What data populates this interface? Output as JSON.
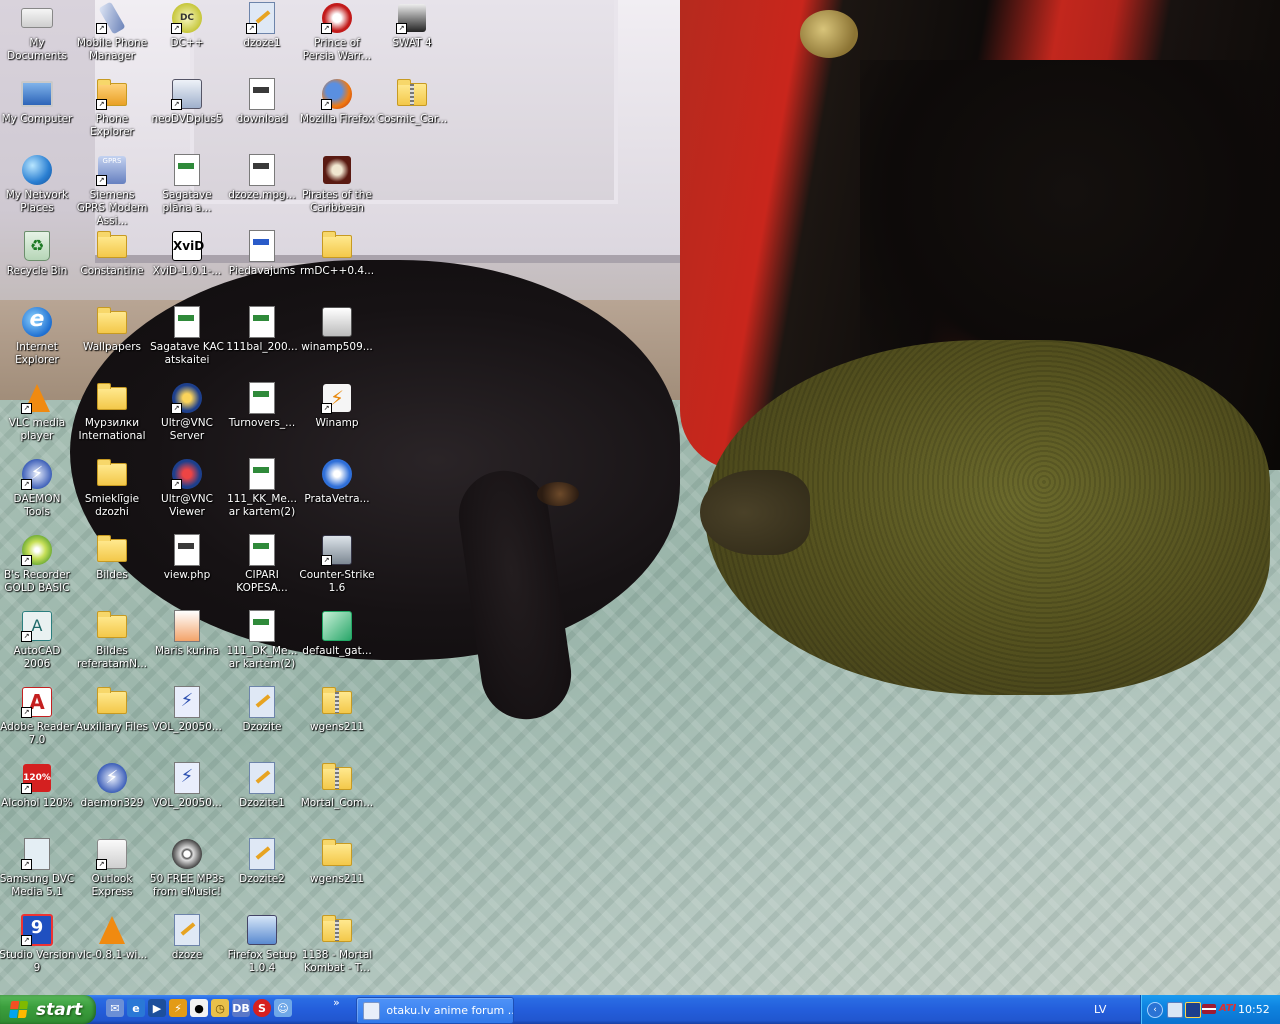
{
  "desktop": {
    "columns": [
      [
        {
          "label": "My Documents",
          "icon": "documents-folder-icon",
          "shortcut": false
        },
        {
          "label": "My Computer",
          "icon": "computer-icon",
          "shortcut": false
        },
        {
          "label": "My Network Places",
          "icon": "network-places-icon",
          "shortcut": false
        },
        {
          "label": "Recycle Bin",
          "icon": "recycle-bin-icon",
          "shortcut": false
        },
        {
          "label": "Internet Explorer",
          "icon": "internet-explorer-icon",
          "shortcut": false
        },
        {
          "label": "VLC media player",
          "icon": "vlc-cone-icon",
          "shortcut": true
        },
        {
          "label": "DAEMON Tools",
          "icon": "daemon-tools-icon",
          "shortcut": true
        },
        {
          "label": "B's Recorder GOLD BASIC",
          "icon": "disc-recorder-icon",
          "shortcut": true
        },
        {
          "label": "AutoCAD 2006",
          "icon": "autocad-icon",
          "shortcut": true
        },
        {
          "label": "Adobe Reader 7.0",
          "icon": "adobe-reader-icon",
          "shortcut": true
        },
        {
          "label": "Alcohol 120%",
          "icon": "alcohol-120-icon",
          "shortcut": true
        },
        {
          "label": "Samsung DVC Media 5.1",
          "icon": "samsung-media-icon",
          "shortcut": true
        },
        {
          "label": "Studio Version 9",
          "icon": "studio-9-icon",
          "shortcut": true
        }
      ],
      [
        {
          "label": "Mobile Phone Manager",
          "icon": "phone-manager-icon",
          "shortcut": true
        },
        {
          "label": "Phone Explorer",
          "icon": "phone-explorer-icon",
          "shortcut": true
        },
        {
          "label": "Siemens GPRS Modem Assi...",
          "icon": "gprs-modem-icon",
          "shortcut": true
        },
        {
          "label": "Constantine",
          "icon": "folder-icon",
          "shortcut": false
        },
        {
          "label": "Wallpapers",
          "icon": "folder-icon",
          "shortcut": false
        },
        {
          "label": "Мурзилки International",
          "icon": "folder-icon",
          "shortcut": false
        },
        {
          "label": "Smieklīgie dzozhi",
          "icon": "folder-icon",
          "shortcut": false
        },
        {
          "label": "Bildes",
          "icon": "folder-icon",
          "shortcut": false
        },
        {
          "label": "Bildes referatamN...",
          "icon": "folder-icon",
          "shortcut": false
        },
        {
          "label": "Auxiliary Files",
          "icon": "folder-icon",
          "shortcut": false
        },
        {
          "label": "daemon329",
          "icon": "daemon-tools-icon",
          "shortcut": false
        },
        {
          "label": "Outlook Express",
          "icon": "outlook-express-icon",
          "shortcut": true
        },
        {
          "label": "vlc-0.8.1-wi...",
          "icon": "vlc-cone-icon",
          "shortcut": false
        }
      ],
      [
        {
          "label": "DC++",
          "icon": "dcpp-icon",
          "shortcut": true
        },
        {
          "label": "neoDVDplus5",
          "icon": "neodvd-icon",
          "shortcut": true
        },
        {
          "label": "Sagatave plāna a...",
          "icon": "excel-file-icon",
          "shortcut": false
        },
        {
          "label": "XviD-1.0.1-...",
          "icon": "xvid-icon",
          "shortcut": false
        },
        {
          "label": "Sagatave KAC atskaitei",
          "icon": "excel-file-icon",
          "shortcut": false
        },
        {
          "label": "Ultr@VNC Server",
          "icon": "vnc-server-icon",
          "shortcut": true
        },
        {
          "label": "Ultr@VNC Viewer",
          "icon": "vnc-viewer-icon",
          "shortcut": true
        },
        {
          "label": "view.php",
          "icon": "web-file-icon",
          "shortcut": false
        },
        {
          "label": "Maris kurina",
          "icon": "archive-file-icon",
          "shortcut": false
        },
        {
          "label": "VOL_20050...",
          "icon": "daemon-image-icon",
          "shortcut": false
        },
        {
          "label": "VOL_20050...",
          "icon": "daemon-image-icon",
          "shortcut": false
        },
        {
          "label": "50 FREE MP3s from eMusic!",
          "icon": "film-reel-icon",
          "shortcut": false
        },
        {
          "label": "dzoze",
          "icon": "media-file-icon",
          "shortcut": false
        }
      ],
      [
        {
          "label": "dzoze1",
          "icon": "media-file-icon",
          "shortcut": true
        },
        {
          "label": "download",
          "icon": "web-file-icon",
          "shortcut": false
        },
        {
          "label": "dzoze.mpg...",
          "icon": "web-file-icon",
          "shortcut": false
        },
        {
          "label": "Piedavajums",
          "icon": "word-file-icon",
          "shortcut": false
        },
        {
          "label": "111bal_200...",
          "icon": "excel-file-icon",
          "shortcut": false
        },
        {
          "label": "Turnovers_...",
          "icon": "excel-file-icon",
          "shortcut": false
        },
        {
          "label": "111_KK_Me... ar kartem(2)",
          "icon": "excel-file-icon",
          "shortcut": false
        },
        {
          "label": "CIPARI KOPESA...",
          "icon": "excel-file-icon",
          "shortcut": false
        },
        {
          "label": "111_DK_Me... ar kartem(2)",
          "icon": "excel-file-icon",
          "shortcut": false
        },
        {
          "label": "Dzozite",
          "icon": "media-file-icon",
          "shortcut": false
        },
        {
          "label": "Dzozite1",
          "icon": "media-file-icon",
          "shortcut": false
        },
        {
          "label": "Dzozite2",
          "icon": "media-file-icon",
          "shortcut": false
        },
        {
          "label": "Firefox Setup 1.0.4",
          "icon": "installer-icon",
          "shortcut": false
        }
      ],
      [
        {
          "label": "Prince of Persia Warr...",
          "icon": "prince-of-persia-icon",
          "shortcut": true
        },
        {
          "label": "Mozilla Firefox",
          "icon": "firefox-icon",
          "shortcut": true
        },
        {
          "label": "Pirates of the Caribbean",
          "icon": "pirates-skull-icon",
          "shortcut": false
        },
        {
          "label": "rmDC++0.4...",
          "icon": "folder-icon",
          "shortcut": false
        },
        {
          "label": "winamp509...",
          "icon": "winamp-installer-icon",
          "shortcut": false
        },
        {
          "label": "Winamp",
          "icon": "winamp-icon",
          "shortcut": true
        },
        {
          "label": "PrataVetra...",
          "icon": "media-player-file-icon",
          "shortcut": false
        },
        {
          "label": "Counter-Strike 1.6",
          "icon": "counter-strike-icon",
          "shortcut": true
        },
        {
          "label": "default_gat...",
          "icon": "gateway-file-icon",
          "shortcut": false
        },
        {
          "label": "wgens211",
          "icon": "zip-folder-icon",
          "shortcut": false
        },
        {
          "label": "Mortal_Com...",
          "icon": "zip-folder-icon",
          "shortcut": false
        },
        {
          "label": "wgens211",
          "icon": "folder-icon",
          "shortcut": false
        },
        {
          "label": "1138 - Mortal Kombat - T...",
          "icon": "zip-folder-icon",
          "shortcut": false
        }
      ],
      [
        {
          "label": "SWAT 4",
          "icon": "swat-4-icon",
          "shortcut": true
        },
        {
          "label": "Cosmic_Car...",
          "icon": "zip-folder-icon",
          "shortcut": false
        }
      ]
    ]
  },
  "taskbar": {
    "start_label": "start",
    "quick_launch": [
      "outlook-express-icon",
      "internet-explorer-icon",
      "media-player-icon",
      "winamp-icon",
      "panda-icon",
      "clock-app-icon",
      "db-icon",
      "skype-icon",
      "messenger-icon"
    ],
    "more_label": "»",
    "task_window_label": "otaku.lv anime forum ...",
    "language": "LV",
    "tray_icons": [
      "network-icon",
      "vnc-tray-icon",
      "flag-icon",
      "ati-icon"
    ],
    "tray_text": "ATI",
    "clock": "10:52"
  },
  "colors": {
    "taskbar_blue": "#245edb",
    "start_green": "#3c9f3e",
    "tray_blue": "#0f84e0"
  }
}
